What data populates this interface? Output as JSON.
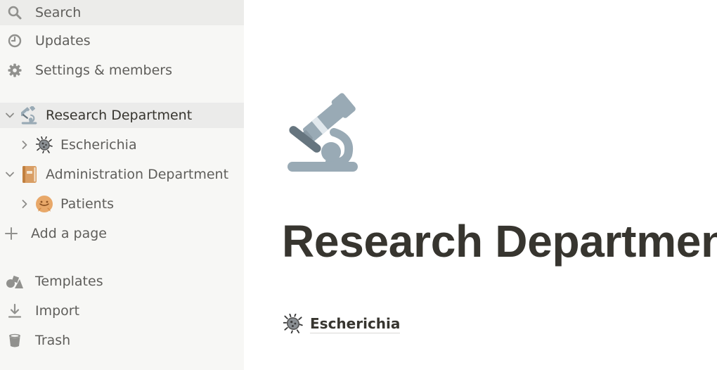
{
  "sidebar": {
    "top_items": [
      {
        "label": "Search",
        "icon": "search-icon"
      },
      {
        "label": "Updates",
        "icon": "clock-icon"
      },
      {
        "label": "Settings & members",
        "icon": "gear-icon"
      }
    ],
    "tree": [
      {
        "label": "Research Department",
        "icon": "microscope-icon",
        "expanded": true,
        "selected": true
      },
      {
        "label": "Escherichia",
        "icon": "microbe-icon",
        "expanded": false
      },
      {
        "label": "Administration Department",
        "icon": "ledger-icon",
        "expanded": true
      },
      {
        "label": "Patients",
        "icon": "smiley-face-icon",
        "expanded": false
      }
    ],
    "add_page_label": "Add a page",
    "bottom_items": [
      {
        "label": "Templates",
        "icon": "shapes-icon"
      },
      {
        "label": "Import",
        "icon": "download-icon"
      },
      {
        "label": "Trash",
        "icon": "trash-icon"
      }
    ]
  },
  "main": {
    "page_icon": "microscope-icon",
    "title": "Research Department",
    "subpages": [
      {
        "label": "Escherichia",
        "icon": "microbe-icon"
      }
    ]
  },
  "colors": {
    "sidebar_bg": "#f7f7f5",
    "sidebar_hover": "#ececea",
    "text_primary": "#37352f",
    "text_secondary": "#5f5e5b",
    "icon_gray": "#91918e"
  }
}
